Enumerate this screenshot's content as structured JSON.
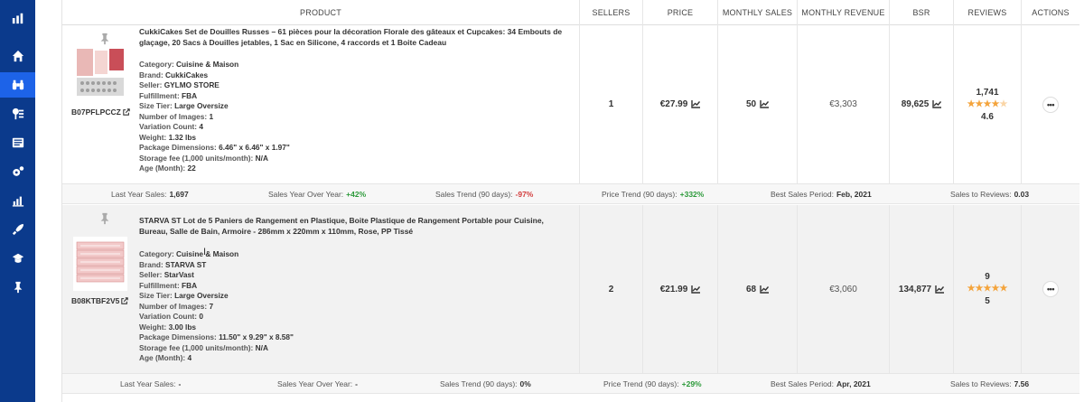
{
  "sidebar": {
    "icons": [
      "logo-icon",
      "home-icon",
      "binoculars-icon",
      "keyword-icon",
      "listing-icon",
      "settings-gears-icon",
      "analytics-icon",
      "rocket-icon",
      "graduation-cap-icon",
      "pin-icon"
    ]
  },
  "table": {
    "headers": [
      "PRODUCT",
      "SELLERS",
      "PRICE",
      "MONTHLY SALES",
      "MONTHLY REVENUE",
      "BSR",
      "REVIEWS",
      "ACTIONS"
    ]
  },
  "products": [
    {
      "title": "CukkiCakes Set de Douilles Russes – 61 pièces pour la décoration Florale des gâteaux et Cupcakes: 34 Embouts de glaçage, 20 Sacs à Douilles jetables, 1 Sac en Silicone, 4 raccords et 1 Boite Cadeau",
      "asin": "B07PFLPCCZ",
      "details": [
        {
          "label": "Category:",
          "value": "Cuisine & Maison"
        },
        {
          "label": "Brand:",
          "value": "CukkiCakes"
        },
        {
          "label": "Seller:",
          "value": "GYLMO STORE"
        },
        {
          "label": "Fulfillment:",
          "value": "FBA"
        },
        {
          "label": "Size Tier:",
          "value": "Large Oversize"
        },
        {
          "label": "Number of Images:",
          "value": "1"
        },
        {
          "label": "Variation Count:",
          "value": "4"
        },
        {
          "label": "Weight:",
          "value": "1.32 lbs"
        },
        {
          "label": "Package Dimensions:",
          "value": "6.46\" x 6.46\" x 1.97\""
        },
        {
          "label": "Storage fee (1,000 units/month):",
          "value": "N/A"
        },
        {
          "label": "Age (Month):",
          "value": "22"
        }
      ],
      "sellers": "1",
      "price": "€27.99",
      "monthly_sales": "50",
      "monthly_revenue": "€3,303",
      "bsr": "89,625",
      "review_count": "1,741",
      "rating": "4.6",
      "stars_full": 4,
      "stars_half": 1,
      "stats": {
        "last_year_label": "Last Year Sales:",
        "last_year": "1,697",
        "yoy_label": "Sales Year Over Year:",
        "yoy": "+42%",
        "trend_label": "Sales Trend (90 days):",
        "trend": "-97%",
        "price_trend_label": "Price Trend (90 days):",
        "price_trend": "+332%",
        "best_label": "Best Sales Period:",
        "best": "Feb, 2021",
        "s2r_label": "Sales to Reviews:",
        "s2r": "0.03"
      }
    },
    {
      "title": "STARVA ST Lot de 5 Paniers de Rangement en Plastique, Boite Plastique de Rangement Portable pour Cuisine, Bureau, Salle de Bain, Armoire - 286mm x 220mm x 110mm, Rose, PP Tissé",
      "asin": "B08KTBF2V5",
      "details": [
        {
          "label": "Category:",
          "value": "Cuisine & Maison"
        },
        {
          "label": "Brand:",
          "value": "STARVA ST"
        },
        {
          "label": "Seller:",
          "value": "StarVast"
        },
        {
          "label": "Fulfillment:",
          "value": "FBA"
        },
        {
          "label": "Size Tier:",
          "value": "Large Oversize"
        },
        {
          "label": "Number of Images:",
          "value": "7"
        },
        {
          "label": "Variation Count:",
          "value": "0"
        },
        {
          "label": "Weight:",
          "value": "3.00 lbs"
        },
        {
          "label": "Package Dimensions:",
          "value": "11.50\" x 9.29\" x 8.58\""
        },
        {
          "label": "Storage fee (1,000 units/month):",
          "value": "N/A"
        },
        {
          "label": "Age (Month):",
          "value": "4"
        }
      ],
      "sellers": "2",
      "price": "€21.99",
      "monthly_sales": "68",
      "monthly_revenue": "€3,060",
      "bsr": "134,877",
      "review_count": "9",
      "rating": "5",
      "stars_full": 5,
      "stars_half": 0,
      "stats": {
        "last_year_label": "Last Year Sales:",
        "last_year": "-",
        "yoy_label": "Sales Year Over Year:",
        "yoy": "-",
        "trend_label": "Sales Trend (90 days):",
        "trend": "0%",
        "price_trend_label": "Price Trend (90 days):",
        "price_trend": "+29%",
        "best_label": "Best Sales Period:",
        "best": "Apr, 2021",
        "s2r_label": "Sales to Reviews:",
        "s2r": "7.56"
      }
    }
  ],
  "actions": {
    "more_label": "•••"
  },
  "colors": {
    "sidebar": "#0b3a8c",
    "sidebar_active": "#1d63e8",
    "positive": "#2c9a3a",
    "negative": "#d23b3b",
    "star": "#f4a43c"
  }
}
